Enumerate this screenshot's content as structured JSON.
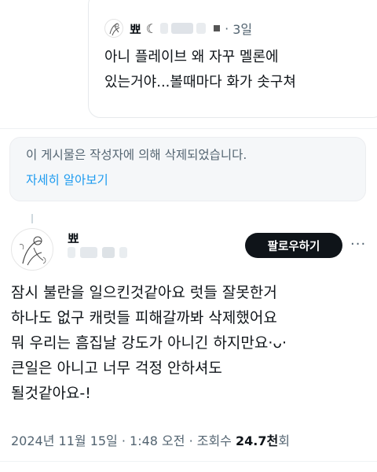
{
  "quoted": {
    "name": "뾰",
    "time": "3일",
    "text_line1": "아니 플레이브 왜 자꾸 멜론에",
    "text_line2": "있는거야...볼때마다 화가 솟구쳐"
  },
  "notice": {
    "deleted": "이 게시물은 작성자에 의해 삭제되었습니다.",
    "learn_more": "자세히 알아보기"
  },
  "tweet": {
    "name": "뾰",
    "follow_label": "팔로우하기",
    "more_label": "···",
    "lines": [
      "잠시 불란을 일으킨것같아요 럿들 잘못한거",
      "하나도 없구 캐럿들 피해갈까봐 삭제했어요",
      "뭐 우리는 흠집날 강도가 아니긴 하지만요·ᴗ·",
      "큰일은 아니고 너무 걱정 안하셔도",
      "될것같아요-!"
    ],
    "date": "2024년 11월 15일 · 1:48 오전 · 조회수 ",
    "views_value": "24.7천",
    "views_suffix": "회"
  },
  "colors": {
    "accent": "#1d9bf0",
    "secondary_text": "#536471",
    "primary_text": "#0f1419"
  }
}
